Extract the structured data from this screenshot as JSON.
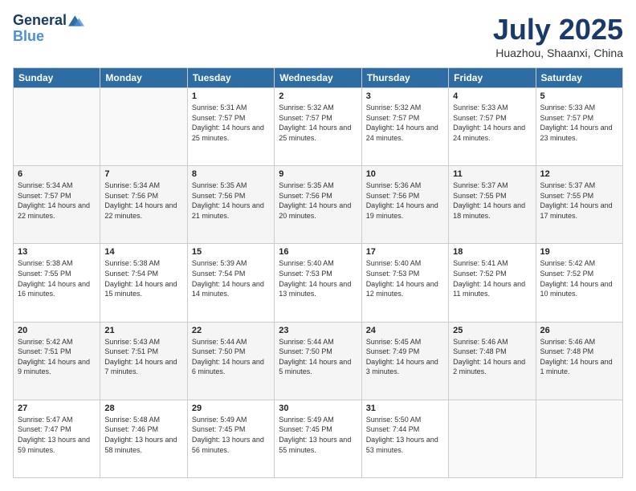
{
  "header": {
    "logo_line1": "General",
    "logo_line2": "Blue",
    "title": "July 2025",
    "subtitle": "Huazhou, Shaanxi, China"
  },
  "weekdays": [
    "Sunday",
    "Monday",
    "Tuesday",
    "Wednesday",
    "Thursday",
    "Friday",
    "Saturday"
  ],
  "weeks": [
    [
      {
        "day": "",
        "info": ""
      },
      {
        "day": "",
        "info": ""
      },
      {
        "day": "1",
        "info": "Sunrise: 5:31 AM\nSunset: 7:57 PM\nDaylight: 14 hours and 25 minutes."
      },
      {
        "day": "2",
        "info": "Sunrise: 5:32 AM\nSunset: 7:57 PM\nDaylight: 14 hours and 25 minutes."
      },
      {
        "day": "3",
        "info": "Sunrise: 5:32 AM\nSunset: 7:57 PM\nDaylight: 14 hours and 24 minutes."
      },
      {
        "day": "4",
        "info": "Sunrise: 5:33 AM\nSunset: 7:57 PM\nDaylight: 14 hours and 24 minutes."
      },
      {
        "day": "5",
        "info": "Sunrise: 5:33 AM\nSunset: 7:57 PM\nDaylight: 14 hours and 23 minutes."
      }
    ],
    [
      {
        "day": "6",
        "info": "Sunrise: 5:34 AM\nSunset: 7:57 PM\nDaylight: 14 hours and 22 minutes."
      },
      {
        "day": "7",
        "info": "Sunrise: 5:34 AM\nSunset: 7:56 PM\nDaylight: 14 hours and 22 minutes."
      },
      {
        "day": "8",
        "info": "Sunrise: 5:35 AM\nSunset: 7:56 PM\nDaylight: 14 hours and 21 minutes."
      },
      {
        "day": "9",
        "info": "Sunrise: 5:35 AM\nSunset: 7:56 PM\nDaylight: 14 hours and 20 minutes."
      },
      {
        "day": "10",
        "info": "Sunrise: 5:36 AM\nSunset: 7:56 PM\nDaylight: 14 hours and 19 minutes."
      },
      {
        "day": "11",
        "info": "Sunrise: 5:37 AM\nSunset: 7:55 PM\nDaylight: 14 hours and 18 minutes."
      },
      {
        "day": "12",
        "info": "Sunrise: 5:37 AM\nSunset: 7:55 PM\nDaylight: 14 hours and 17 minutes."
      }
    ],
    [
      {
        "day": "13",
        "info": "Sunrise: 5:38 AM\nSunset: 7:55 PM\nDaylight: 14 hours and 16 minutes."
      },
      {
        "day": "14",
        "info": "Sunrise: 5:38 AM\nSunset: 7:54 PM\nDaylight: 14 hours and 15 minutes."
      },
      {
        "day": "15",
        "info": "Sunrise: 5:39 AM\nSunset: 7:54 PM\nDaylight: 14 hours and 14 minutes."
      },
      {
        "day": "16",
        "info": "Sunrise: 5:40 AM\nSunset: 7:53 PM\nDaylight: 14 hours and 13 minutes."
      },
      {
        "day": "17",
        "info": "Sunrise: 5:40 AM\nSunset: 7:53 PM\nDaylight: 14 hours and 12 minutes."
      },
      {
        "day": "18",
        "info": "Sunrise: 5:41 AM\nSunset: 7:52 PM\nDaylight: 14 hours and 11 minutes."
      },
      {
        "day": "19",
        "info": "Sunrise: 5:42 AM\nSunset: 7:52 PM\nDaylight: 14 hours and 10 minutes."
      }
    ],
    [
      {
        "day": "20",
        "info": "Sunrise: 5:42 AM\nSunset: 7:51 PM\nDaylight: 14 hours and 9 minutes."
      },
      {
        "day": "21",
        "info": "Sunrise: 5:43 AM\nSunset: 7:51 PM\nDaylight: 14 hours and 7 minutes."
      },
      {
        "day": "22",
        "info": "Sunrise: 5:44 AM\nSunset: 7:50 PM\nDaylight: 14 hours and 6 minutes."
      },
      {
        "day": "23",
        "info": "Sunrise: 5:44 AM\nSunset: 7:50 PM\nDaylight: 14 hours and 5 minutes."
      },
      {
        "day": "24",
        "info": "Sunrise: 5:45 AM\nSunset: 7:49 PM\nDaylight: 14 hours and 3 minutes."
      },
      {
        "day": "25",
        "info": "Sunrise: 5:46 AM\nSunset: 7:48 PM\nDaylight: 14 hours and 2 minutes."
      },
      {
        "day": "26",
        "info": "Sunrise: 5:46 AM\nSunset: 7:48 PM\nDaylight: 14 hours and 1 minute."
      }
    ],
    [
      {
        "day": "27",
        "info": "Sunrise: 5:47 AM\nSunset: 7:47 PM\nDaylight: 13 hours and 59 minutes."
      },
      {
        "day": "28",
        "info": "Sunrise: 5:48 AM\nSunset: 7:46 PM\nDaylight: 13 hours and 58 minutes."
      },
      {
        "day": "29",
        "info": "Sunrise: 5:49 AM\nSunset: 7:45 PM\nDaylight: 13 hours and 56 minutes."
      },
      {
        "day": "30",
        "info": "Sunrise: 5:49 AM\nSunset: 7:45 PM\nDaylight: 13 hours and 55 minutes."
      },
      {
        "day": "31",
        "info": "Sunrise: 5:50 AM\nSunset: 7:44 PM\nDaylight: 13 hours and 53 minutes."
      },
      {
        "day": "",
        "info": ""
      },
      {
        "day": "",
        "info": ""
      }
    ]
  ]
}
